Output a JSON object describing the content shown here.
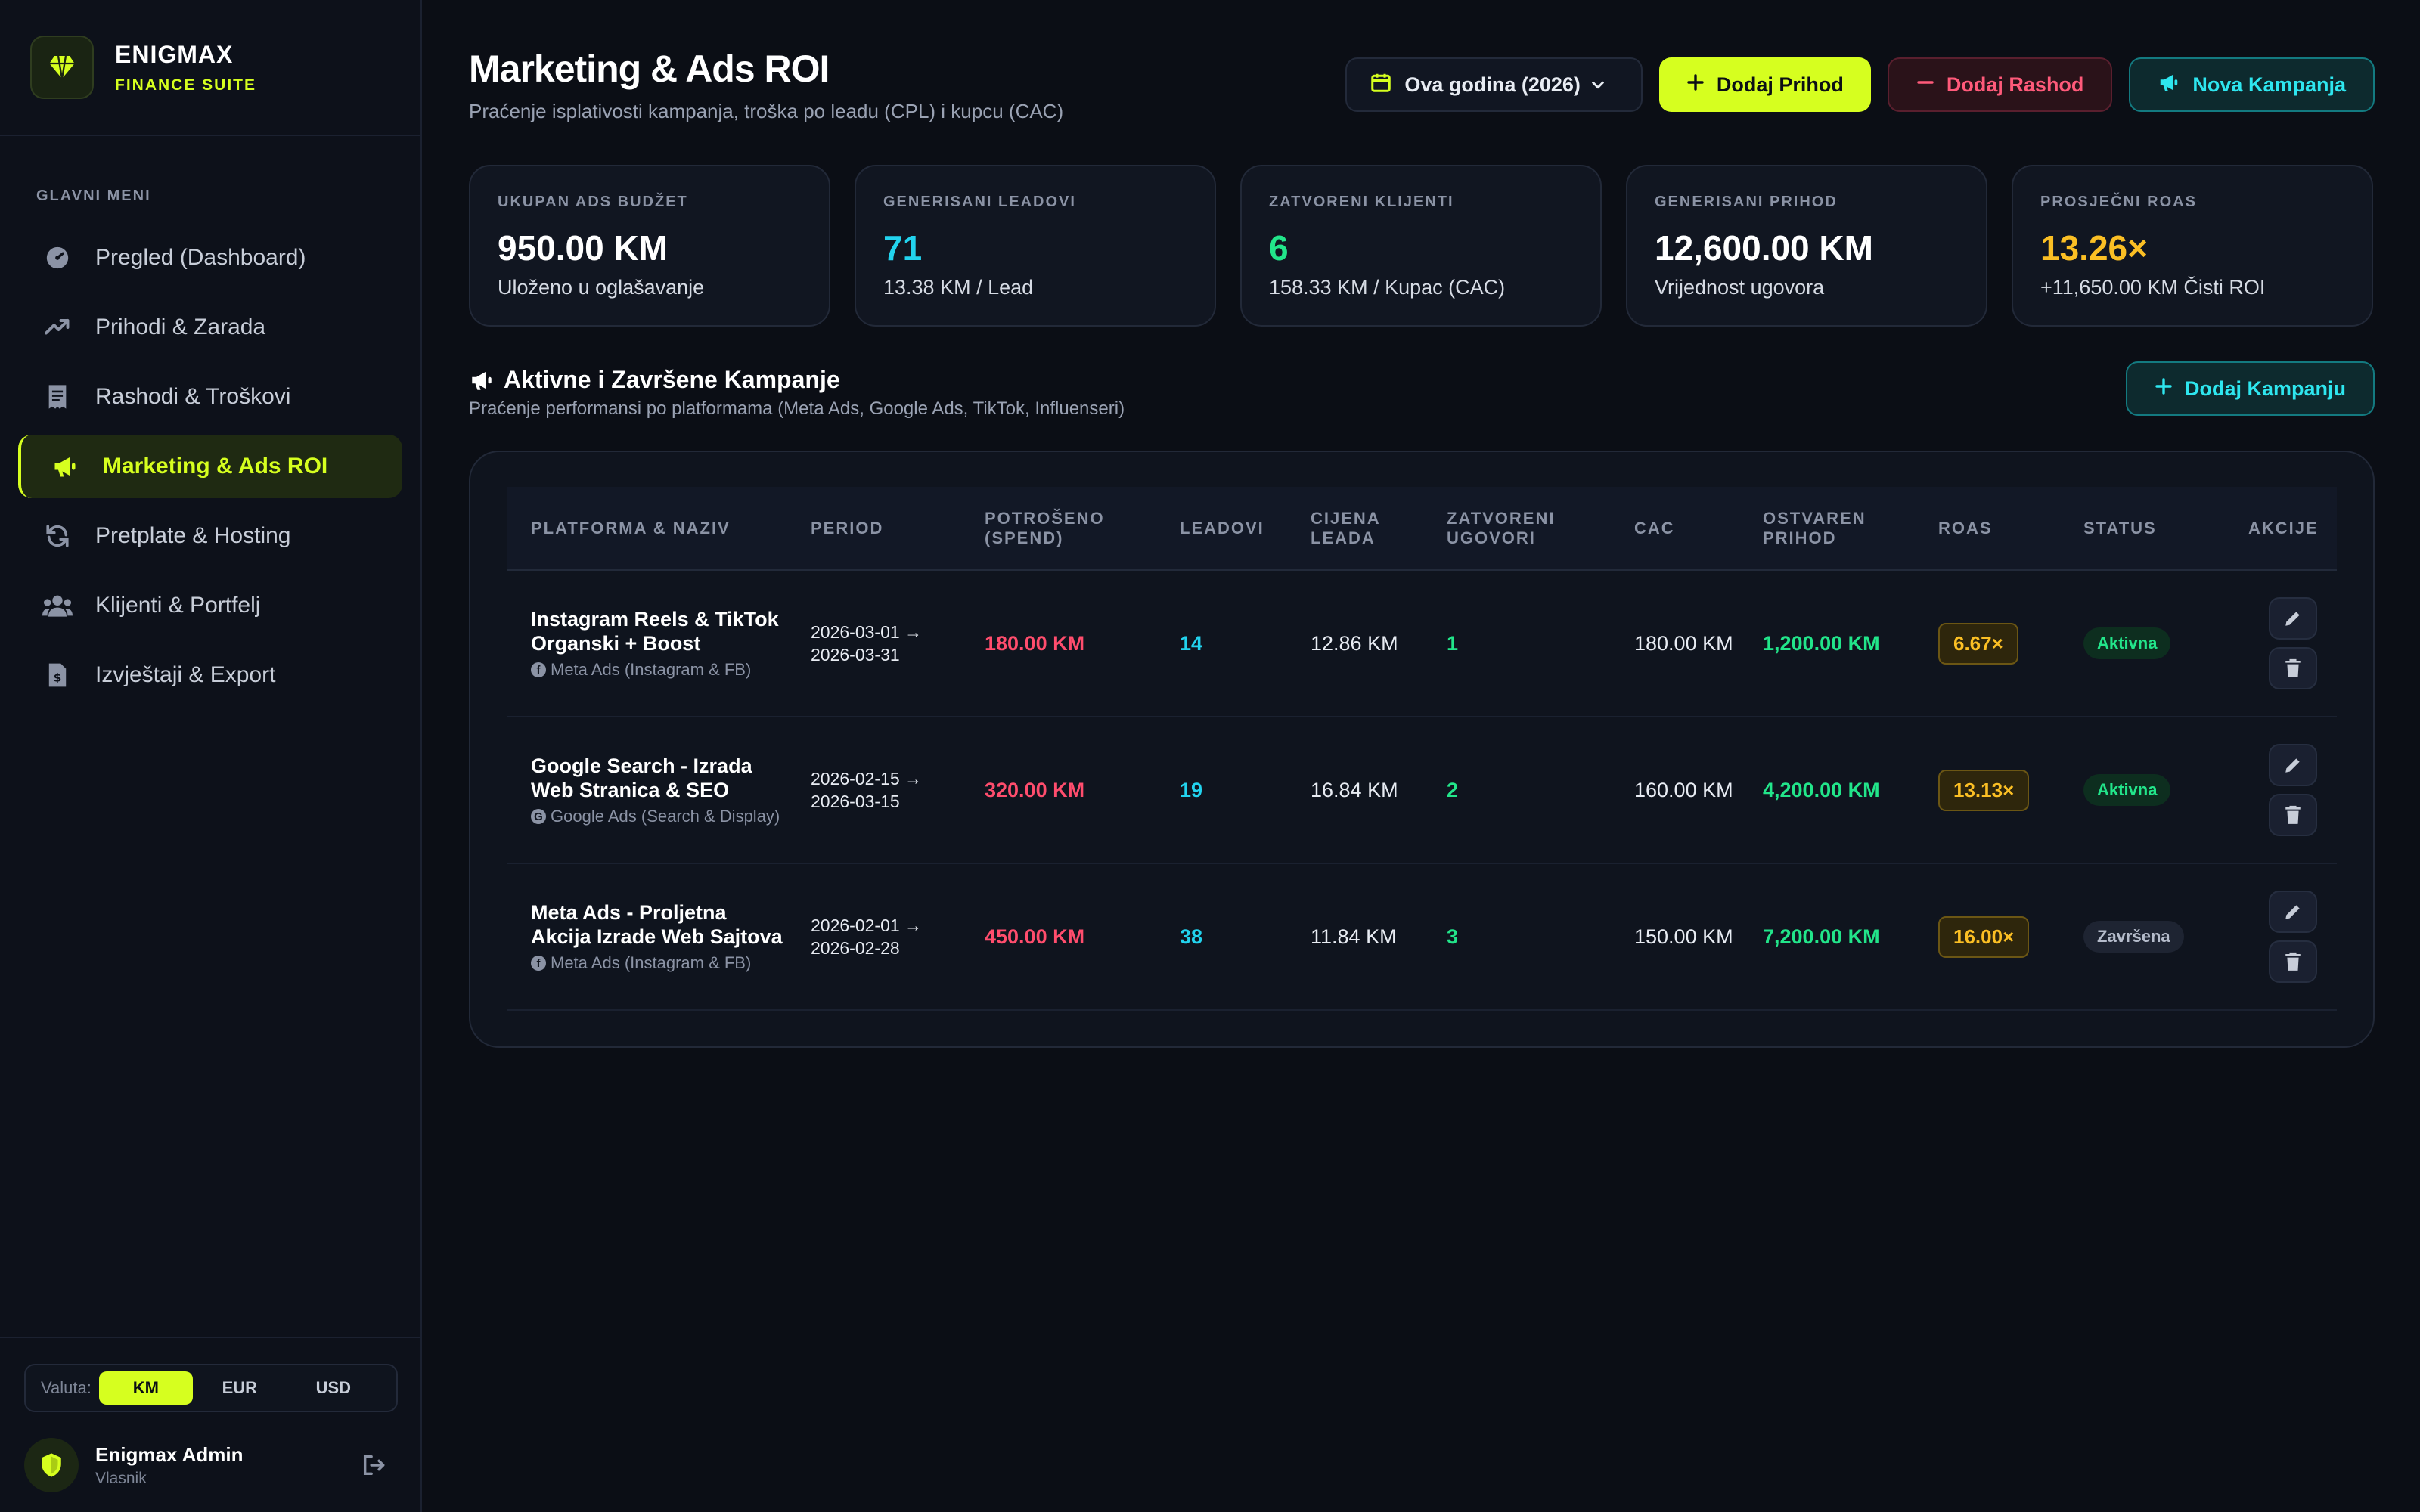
{
  "brand": {
    "name": "ENIGMAX",
    "subtitle": "FINANCE SUITE"
  },
  "sidebar": {
    "menu_label": "GLAVNI MENI",
    "items": [
      {
        "label": "Pregled (Dashboard)",
        "icon": "gauge-icon"
      },
      {
        "label": "Prihodi & Zarada",
        "icon": "trend-up-icon"
      },
      {
        "label": "Rashodi & Troškovi",
        "icon": "receipt-icon"
      },
      {
        "label": "Marketing & Ads ROI",
        "icon": "megaphone-icon",
        "active": true
      },
      {
        "label": "Pretplate & Hosting",
        "icon": "refresh-icon"
      },
      {
        "label": "Klijenti & Portfelj",
        "icon": "users-icon"
      },
      {
        "label": "Izvještaji & Export",
        "icon": "file-invoice-icon"
      }
    ],
    "currency": {
      "label": "Valuta:",
      "options": [
        "KM",
        "EUR",
        "USD"
      ],
      "selected": "KM"
    },
    "user": {
      "name": "Enigmax Admin",
      "role": "Vlasnik"
    }
  },
  "header": {
    "title": "Marketing & Ads ROI",
    "subtitle": "Praćenje isplativosti kampanja, troška po leadu (CPL) i kupcu (CAC)",
    "period": "Ova godina (2026)",
    "add_income": "Dodaj Prihod",
    "add_expense": "Dodaj Rashod",
    "new_campaign": "Nova Kampanja"
  },
  "stats": [
    {
      "label": "UKUPAN ADS BUDŽET",
      "value": "950.00 KM",
      "sub": "Uloženo u oglašavanje",
      "color": "#ffffff"
    },
    {
      "label": "GENERISANI LEADOVI",
      "value": "71",
      "sub": "13.38 KM / Lead",
      "color": "#22d3ee"
    },
    {
      "label": "ZATVORENI KLIJENTI",
      "value": "6",
      "sub": "158.33 KM / Kupac (CAC)",
      "color": "#22e58a"
    },
    {
      "label": "GENERISANI PRIHOD",
      "value": "12,600.00 KM",
      "sub": "Vrijednost ugovora",
      "color": "#ffffff"
    },
    {
      "label": "PROSJEČNI ROAS",
      "value": "13.26×",
      "sub": "+11,650.00 KM Čisti ROI",
      "color": "#fbbf24"
    }
  ],
  "section": {
    "title": "Aktivne i Završene Kampanje",
    "subtitle": "Praćenje performansi po platformama (Meta Ads, Google Ads, TikTok, Influenseri)",
    "add_button": "Dodaj Kampanju"
  },
  "table": {
    "columns": [
      "PLATFORMA & NAZIV",
      "PERIOD",
      "POTROŠENO (SPEND)",
      "LEADOVI",
      "CIJENA LEADA",
      "ZATVORENI UGOVORI",
      "CAC",
      "OSTVAREN PRIHOD",
      "ROAS",
      "STATUS",
      "AKCIJE"
    ],
    "rows": [
      {
        "name": "Instagram Reels & TikTok Organski + Boost",
        "platform": "Meta Ads (Instagram & FB)",
        "period_start": "2026-03-01 →",
        "period_end": "2026-03-31",
        "spend": "180.00 KM",
        "leads": "14",
        "lead_cost": "12.86 KM",
        "closed": "1",
        "cac": "180.00 KM",
        "revenue": "1,200.00 KM",
        "roas": "6.67×",
        "status": "Aktivna",
        "status_type": "active"
      },
      {
        "name": "Google Search - Izrada Web Stranica & SEO",
        "platform": "Google Ads (Search & Display)",
        "period_start": "2026-02-15 →",
        "period_end": "2026-03-15",
        "spend": "320.00 KM",
        "leads": "19",
        "lead_cost": "16.84 KM",
        "closed": "2",
        "cac": "160.00 KM",
        "revenue": "4,200.00 KM",
        "roas": "13.13×",
        "status": "Aktivna",
        "status_type": "active"
      },
      {
        "name": "Meta Ads - Proljetna Akcija Izrade Web Sajtova",
        "platform": "Meta Ads (Instagram & FB)",
        "period_start": "2026-02-01 →",
        "period_end": "2026-02-28",
        "spend": "450.00 KM",
        "leads": "38",
        "lead_cost": "11.84 KM",
        "closed": "3",
        "cac": "150.00 KM",
        "revenue": "7,200.00 KM",
        "roas": "16.00×",
        "status": "Završena",
        "status_type": "done"
      }
    ]
  },
  "colors": {
    "accent": "#d6ff1f",
    "cyan": "#22d3ee",
    "green": "#22e58a",
    "red": "#ff4d6d",
    "yellow": "#fbbf24"
  }
}
